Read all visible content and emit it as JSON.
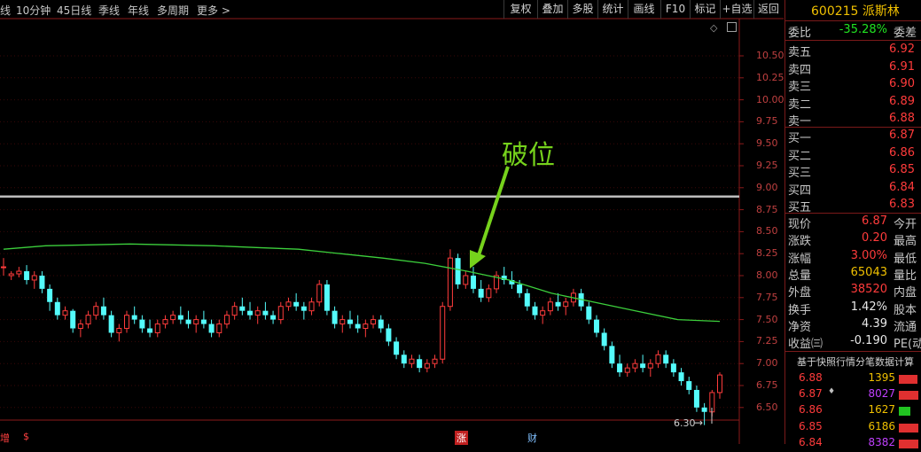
{
  "toolbar": {
    "periods": [
      "线",
      "10分钟",
      "45日线",
      "季线",
      "年线",
      "多周期",
      "更多 >"
    ],
    "buttons": [
      "复权",
      "叠加",
      "多股",
      "统计",
      "画线",
      "F10",
      "标记",
      "+自选",
      "返回"
    ]
  },
  "stock": {
    "code": "600215",
    "name": "派斯林",
    "title": "600215 派斯林"
  },
  "order_book": {
    "webi": {
      "label": "委比",
      "value": "-35.28%",
      "extra": "委差"
    },
    "sell": [
      {
        "label": "卖五",
        "price": "6.92"
      },
      {
        "label": "卖四",
        "price": "6.91"
      },
      {
        "label": "卖三",
        "price": "6.90"
      },
      {
        "label": "卖二",
        "price": "6.89"
      },
      {
        "label": "卖一",
        "price": "6.88"
      }
    ],
    "buy": [
      {
        "label": "买一",
        "price": "6.87"
      },
      {
        "label": "买二",
        "price": "6.86"
      },
      {
        "label": "买三",
        "price": "6.85"
      },
      {
        "label": "买四",
        "price": "6.84"
      },
      {
        "label": "买五",
        "price": "6.83"
      }
    ]
  },
  "quote": [
    {
      "label": "现价",
      "value": "6.87",
      "cls": "up",
      "extra": "今开"
    },
    {
      "label": "涨跌",
      "value": "0.20",
      "cls": "up",
      "extra": "最高"
    },
    {
      "label": "涨幅",
      "value": "3.00%",
      "cls": "up",
      "extra": "最低"
    },
    {
      "label": "总量",
      "value": "65043",
      "cls": "yellow",
      "extra": "量比"
    },
    {
      "label": "外盘",
      "value": "38520",
      "cls": "up",
      "extra": "内盘"
    },
    {
      "label": "换手",
      "value": "1.42%",
      "cls": "white",
      "extra": "股本"
    },
    {
      "label": "净资",
      "value": "4.39",
      "cls": "white",
      "extra": "流通"
    },
    {
      "label": "收益㈢",
      "value": "-0.190",
      "cls": "white",
      "extra": "PE(动"
    }
  ],
  "trades": {
    "title": "基于快照行情分笔数据计算",
    "rows": [
      {
        "price": "6.88",
        "mark": "",
        "vol": "1395",
        "vol_color": "#f0c000",
        "bar": 0.95,
        "bar_color": "#e03030"
      },
      {
        "price": "6.87",
        "mark": "♦",
        "vol": "8027",
        "vol_color": "#c040ff",
        "bar": 1.0,
        "bar_color": "#e03030"
      },
      {
        "price": "6.86",
        "mark": "",
        "vol": "1627",
        "vol_color": "#f0c000",
        "bar": 0.6,
        "bar_color": "#21c321"
      },
      {
        "price": "6.85",
        "mark": "",
        "vol": "6186",
        "vol_color": "#f0c000",
        "bar": 1.0,
        "bar_color": "#e03030"
      },
      {
        "price": "6.84",
        "mark": "",
        "vol": "8382",
        "vol_color": "#c040ff",
        "bar": 1.0,
        "bar_color": "#e03030"
      }
    ]
  },
  "chart": {
    "y_ticks": [
      "10.50",
      "10.25",
      "10.00",
      "9.75",
      "9.50",
      "9.25",
      "9.00",
      "8.75",
      "8.50",
      "8.25",
      "8.00",
      "7.75",
      "7.50",
      "7.25",
      "7.00",
      "6.75",
      "6.50"
    ],
    "annotation": "破位",
    "low_label": "6.30",
    "markers": [
      {
        "text": "增",
        "color": "#ff4040"
      },
      {
        "text": "$",
        "color": "#ff4040"
      },
      {
        "text": "涨",
        "color": "#ffffff",
        "bg": "#c02020"
      },
      {
        "text": "财",
        "color": "#80c0ff"
      }
    ]
  },
  "chart_data": {
    "type": "candlestick",
    "title": "",
    "ylim": [
      6.3,
      10.6
    ],
    "horizontal_line": 8.9,
    "candles": [
      [
        8.1,
        8.2,
        8.0,
        8.1
      ],
      [
        8.0,
        8.05,
        7.95,
        8.02
      ],
      [
        8.02,
        8.1,
        7.98,
        8.05
      ],
      [
        8.05,
        8.12,
        7.9,
        7.95
      ],
      [
        7.95,
        8.05,
        7.85,
        8.0
      ],
      [
        8.0,
        8.05,
        7.8,
        7.85
      ],
      [
        7.85,
        7.9,
        7.6,
        7.7
      ],
      [
        7.7,
        7.75,
        7.5,
        7.55
      ],
      [
        7.55,
        7.65,
        7.5,
        7.6
      ],
      [
        7.6,
        7.62,
        7.35,
        7.4
      ],
      [
        7.4,
        7.5,
        7.3,
        7.45
      ],
      [
        7.45,
        7.6,
        7.4,
        7.55
      ],
      [
        7.55,
        7.7,
        7.5,
        7.65
      ],
      [
        7.65,
        7.75,
        7.5,
        7.55
      ],
      [
        7.55,
        7.6,
        7.3,
        7.35
      ],
      [
        7.35,
        7.45,
        7.25,
        7.4
      ],
      [
        7.4,
        7.6,
        7.35,
        7.55
      ],
      [
        7.55,
        7.65,
        7.45,
        7.5
      ],
      [
        7.5,
        7.55,
        7.35,
        7.4
      ],
      [
        7.4,
        7.5,
        7.3,
        7.35
      ],
      [
        7.35,
        7.5,
        7.3,
        7.45
      ],
      [
        7.45,
        7.55,
        7.4,
        7.5
      ],
      [
        7.5,
        7.6,
        7.45,
        7.55
      ],
      [
        7.55,
        7.65,
        7.45,
        7.5
      ],
      [
        7.5,
        7.6,
        7.4,
        7.45
      ],
      [
        7.45,
        7.55,
        7.35,
        7.5
      ],
      [
        7.5,
        7.6,
        7.4,
        7.45
      ],
      [
        7.45,
        7.5,
        7.3,
        7.35
      ],
      [
        7.35,
        7.5,
        7.3,
        7.45
      ],
      [
        7.45,
        7.6,
        7.4,
        7.55
      ],
      [
        7.55,
        7.7,
        7.5,
        7.65
      ],
      [
        7.65,
        7.75,
        7.55,
        7.6
      ],
      [
        7.6,
        7.7,
        7.5,
        7.55
      ],
      [
        7.55,
        7.65,
        7.45,
        7.6
      ],
      [
        7.6,
        7.7,
        7.5,
        7.55
      ],
      [
        7.55,
        7.6,
        7.45,
        7.5
      ],
      [
        7.5,
        7.7,
        7.45,
        7.65
      ],
      [
        7.65,
        7.75,
        7.6,
        7.7
      ],
      [
        7.7,
        7.8,
        7.6,
        7.65
      ],
      [
        7.65,
        7.7,
        7.5,
        7.6
      ],
      [
        7.6,
        7.75,
        7.55,
        7.7
      ],
      [
        7.7,
        7.95,
        7.65,
        7.9
      ],
      [
        7.9,
        7.95,
        7.55,
        7.6
      ],
      [
        7.6,
        7.65,
        7.4,
        7.45
      ],
      [
        7.45,
        7.55,
        7.35,
        7.5
      ],
      [
        7.5,
        7.6,
        7.4,
        7.45
      ],
      [
        7.45,
        7.55,
        7.35,
        7.4
      ],
      [
        7.4,
        7.5,
        7.3,
        7.45
      ],
      [
        7.45,
        7.55,
        7.4,
        7.5
      ],
      [
        7.5,
        7.55,
        7.35,
        7.4
      ],
      [
        7.4,
        7.45,
        7.2,
        7.25
      ],
      [
        7.25,
        7.3,
        7.05,
        7.1
      ],
      [
        7.1,
        7.15,
        6.95,
        7.0
      ],
      [
        7.0,
        7.1,
        6.95,
        7.05
      ],
      [
        7.05,
        7.1,
        6.9,
        6.95
      ],
      [
        6.95,
        7.05,
        6.9,
        7.0
      ],
      [
        7.0,
        7.1,
        6.95,
        7.05
      ],
      [
        7.05,
        7.7,
        7.0,
        7.65
      ],
      [
        7.65,
        8.3,
        7.6,
        8.2
      ],
      [
        8.2,
        8.25,
        7.85,
        7.9
      ],
      [
        7.9,
        8.05,
        7.85,
        8.0
      ],
      [
        8.0,
        8.1,
        7.8,
        7.85
      ],
      [
        7.85,
        7.95,
        7.7,
        7.75
      ],
      [
        7.75,
        7.9,
        7.7,
        7.85
      ],
      [
        7.85,
        8.05,
        7.8,
        8.0
      ],
      [
        8.0,
        8.1,
        7.9,
        7.95
      ],
      [
        7.95,
        8.05,
        7.85,
        7.9
      ],
      [
        7.9,
        7.95,
        7.75,
        7.8
      ],
      [
        7.8,
        7.85,
        7.6,
        7.65
      ],
      [
        7.65,
        7.7,
        7.5,
        7.55
      ],
      [
        7.55,
        7.65,
        7.45,
        7.6
      ],
      [
        7.6,
        7.75,
        7.55,
        7.7
      ],
      [
        7.7,
        7.8,
        7.6,
        7.65
      ],
      [
        7.65,
        7.75,
        7.55,
        7.7
      ],
      [
        7.7,
        7.85,
        7.65,
        7.8
      ],
      [
        7.8,
        7.85,
        7.6,
        7.65
      ],
      [
        7.65,
        7.7,
        7.45,
        7.5
      ],
      [
        7.5,
        7.55,
        7.3,
        7.35
      ],
      [
        7.35,
        7.4,
        7.15,
        7.2
      ],
      [
        7.2,
        7.25,
        6.95,
        7.0
      ],
      [
        7.0,
        7.1,
        6.85,
        6.9
      ],
      [
        6.9,
        7.0,
        6.85,
        6.95
      ],
      [
        6.95,
        7.05,
        6.9,
        7.0
      ],
      [
        7.0,
        7.1,
        6.9,
        6.95
      ],
      [
        6.95,
        7.05,
        6.85,
        7.0
      ],
      [
        7.0,
        7.15,
        6.95,
        7.1
      ],
      [
        7.1,
        7.15,
        6.95,
        7.0
      ],
      [
        7.0,
        7.05,
        6.85,
        6.9
      ],
      [
        6.9,
        6.95,
        6.75,
        6.8
      ],
      [
        6.8,
        6.85,
        6.65,
        6.7
      ],
      [
        6.7,
        6.75,
        6.45,
        6.5
      ],
      [
        6.5,
        6.55,
        6.3,
        6.45
      ],
      [
        6.45,
        6.7,
        6.4,
        6.67
      ],
      [
        6.67,
        6.9,
        6.6,
        6.87
      ]
    ],
    "ma": [
      8.3,
      8.34,
      8.35,
      8.36,
      8.35,
      8.34,
      8.32,
      8.3,
      8.25,
      8.2,
      8.14,
      8.05,
      7.95,
      7.8,
      7.7,
      7.6,
      7.5,
      7.48
    ]
  }
}
